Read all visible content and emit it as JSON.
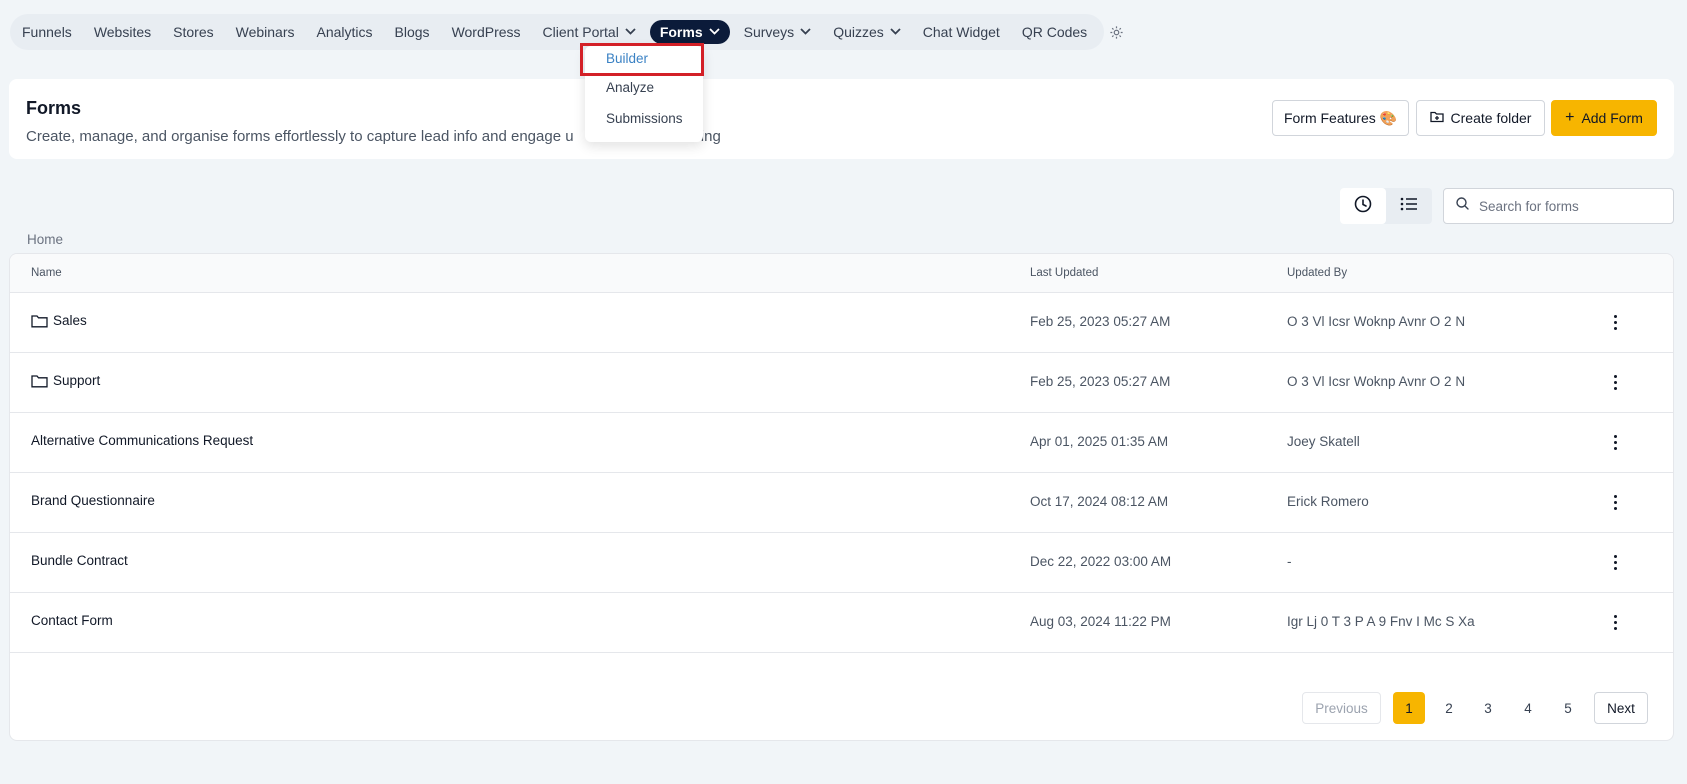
{
  "nav": {
    "items": [
      {
        "label": "Funnels",
        "has_chevron": false
      },
      {
        "label": "Websites",
        "has_chevron": false
      },
      {
        "label": "Stores",
        "has_chevron": false
      },
      {
        "label": "Webinars",
        "has_chevron": false
      },
      {
        "label": "Analytics",
        "has_chevron": false
      },
      {
        "label": "Blogs",
        "has_chevron": false
      },
      {
        "label": "WordPress",
        "has_chevron": false
      },
      {
        "label": "Client Portal",
        "has_chevron": true
      },
      {
        "label": "Forms",
        "has_chevron": true,
        "active": true
      },
      {
        "label": "Surveys",
        "has_chevron": true
      },
      {
        "label": "Quizzes",
        "has_chevron": true
      },
      {
        "label": "Chat Widget",
        "has_chevron": false
      },
      {
        "label": "QR Codes",
        "has_chevron": false
      }
    ],
    "settings_icon": "gear-icon"
  },
  "dropdown": {
    "items": [
      "Builder",
      "Analyze",
      "Submissions"
    ],
    "highlighted": "Builder"
  },
  "header": {
    "title": "Forms",
    "description": "Create, manage, and organise forms effortlessly to capture lead info and engage u",
    "description_tail": "coding",
    "buttons": {
      "features": "Form Features 🎨",
      "create_folder": "Create folder",
      "add_form": "Add Form"
    }
  },
  "toolbar": {
    "search_placeholder": "Search for forms"
  },
  "breadcrumb": "Home",
  "table": {
    "columns": [
      "Name",
      "Last Updated",
      "Updated By"
    ],
    "rows": [
      {
        "name": "Sales",
        "folder": true,
        "last_updated": "Feb 25, 2023 05:27 AM",
        "updated_by": "O 3 Vl Icsr Woknp Avnr O 2 N"
      },
      {
        "name": "Support",
        "folder": true,
        "last_updated": "Feb 25, 2023 05:27 AM",
        "updated_by": "O 3 Vl Icsr Woknp Avnr O 2 N"
      },
      {
        "name": "Alternative Communications Request",
        "folder": false,
        "last_updated": "Apr 01, 2025 01:35 AM",
        "updated_by": "Joey Skatell"
      },
      {
        "name": "Brand Questionnaire",
        "folder": false,
        "last_updated": "Oct 17, 2024 08:12 AM",
        "updated_by": "Erick Romero"
      },
      {
        "name": "Bundle Contract",
        "folder": false,
        "last_updated": "Dec 22, 2022 03:00 AM",
        "updated_by": "-"
      },
      {
        "name": "Contact Form",
        "folder": false,
        "last_updated": "Aug 03, 2024 11:22 PM",
        "updated_by": "Igr Lj 0 T 3 P A 9 Fnv I Mc S Xa"
      }
    ]
  },
  "pagination": {
    "previous": "Previous",
    "next": "Next",
    "pages": [
      "1",
      "2",
      "3",
      "4",
      "5"
    ],
    "current": "1"
  },
  "colors": {
    "accent": "#f7b500",
    "nav_active": "#0b1b3a",
    "highlight_box": "#d32027",
    "link": "#3b82c4"
  }
}
